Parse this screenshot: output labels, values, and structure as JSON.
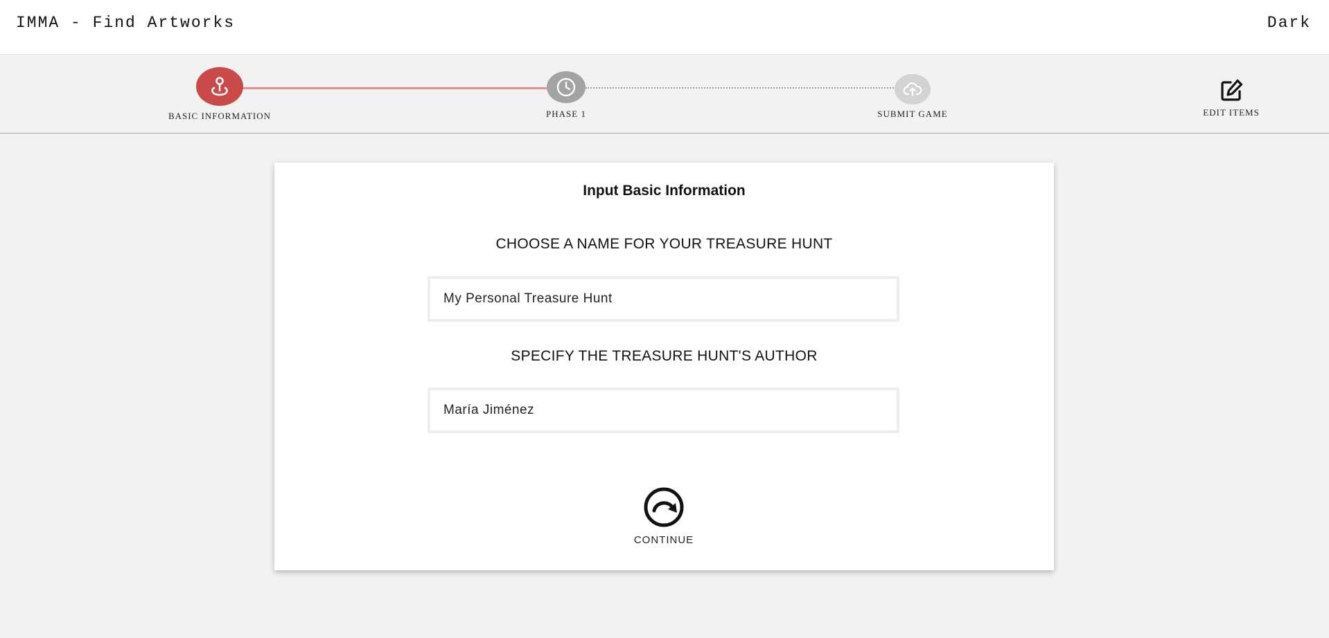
{
  "header": {
    "app_title": "IMMA - Find Artworks",
    "theme_toggle": "Dark"
  },
  "stepper": {
    "steps": [
      {
        "label": "BASIC INFORMATION",
        "icon": "map-pin-icon",
        "state": "active"
      },
      {
        "label": "PHASE 1",
        "icon": "clock-icon",
        "state": "pending"
      },
      {
        "label": "SUBMIT GAME",
        "icon": "cloud-upload-icon",
        "state": "disabled"
      },
      {
        "label": "EDIT ITEMS",
        "icon": "edit-icon",
        "state": "available"
      }
    ],
    "colors": {
      "active": "#c94a48",
      "pending": "#a3a3a3",
      "disabled": "#d3d3d3",
      "progress_line": "#ec8d8d"
    }
  },
  "form": {
    "title": "Input Basic Information",
    "name_heading": "CHOOSE A NAME FOR YOUR TREASURE HUNT",
    "name_value": "My Personal Treasure Hunt",
    "author_heading": "SPECIFY THE TREASURE HUNT'S AUTHOR",
    "author_value": "María Jiménez",
    "continue_label": "CONTINUE",
    "continue_icon": "redo-circle-icon"
  }
}
